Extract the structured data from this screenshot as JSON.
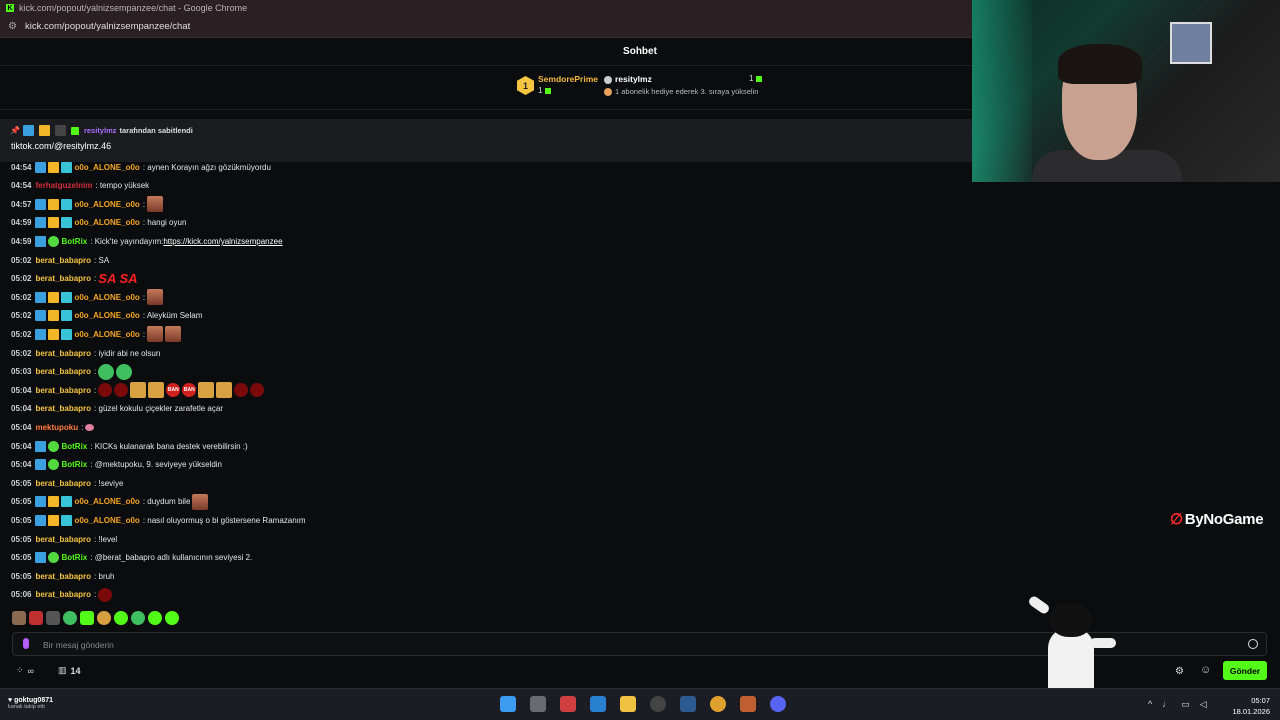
{
  "browser": {
    "window_title": "kick.com/popout/yalnizsempanzee/chat - Google Chrome",
    "url": "kick.com/popout/yalnizsempanzee/chat"
  },
  "chat": {
    "header_title": "Sohbet",
    "leaderboard": {
      "rank": "1",
      "top_user": "SemdorePrime",
      "top_user_count": "1",
      "second_user": "resitylmz",
      "second_user_count": "1",
      "sub_text": "1 abonelik hediye ederek 3. sıraya yükselin"
    },
    "pinned": {
      "pinned_by_user": "resitylmz",
      "pinned_by_text": "tarafından sabitlendi",
      "content": "tiktok.com/@resitylmz.46"
    },
    "messages": [
      {
        "time": "04:54",
        "user": "o0o_ALONE_o0o",
        "text": ": aynen Korayın ağzı gözükmüyordu"
      },
      {
        "time": "04:54",
        "user": "ferhatguzelnim",
        "text": ": tempo yüksek"
      },
      {
        "time": "04:57",
        "user": "o0o_ALONE_o0o",
        "text": ":"
      },
      {
        "time": "04:59",
        "user": "o0o_ALONE_o0o",
        "text": ": hangi oyun"
      },
      {
        "time": "04:59",
        "user": "BotRix",
        "text": ": Kick'te yayındayım: ",
        "link": "https://kick.com/yalnizsempanzee"
      },
      {
        "time": "05:02",
        "user": "berat_babapro",
        "text": ": SA"
      },
      {
        "time": "05:02",
        "user": "berat_babapro",
        "text": ":",
        "big": "SA SA"
      },
      {
        "time": "05:02",
        "user": "o0o_ALONE_o0o",
        "text": ":"
      },
      {
        "time": "05:02",
        "user": "o0o_ALONE_o0o",
        "text": ": Aleyküm Selam"
      },
      {
        "time": "05:02",
        "user": "o0o_ALONE_o0o",
        "text": ":"
      },
      {
        "time": "05:02",
        "user": "berat_babapro",
        "text": ": iyidir abi ne olsun"
      },
      {
        "time": "05:03",
        "user": "berat_babapro",
        "text": ":"
      },
      {
        "time": "05:04",
        "user": "berat_babapro",
        "text": ":",
        "ban": "BAN"
      },
      {
        "time": "05:04",
        "user": "berat_babapro",
        "text": ": güzel kokulu çiçekler zarafetle açar"
      },
      {
        "time": "05:04",
        "user": "mektupoku",
        "text": ":"
      },
      {
        "time": "05:04",
        "user": "BotRix",
        "text": ": KICKs kulanarak bana destek verebilirsin :)"
      },
      {
        "time": "05:04",
        "user": "BotRix",
        "text": ": @mektupoku, 9. seviyeye yükseldin"
      },
      {
        "time": "05:05",
        "user": "berat_babapro",
        "text": ": !seviye"
      },
      {
        "time": "05:05",
        "user": "o0o_ALONE_o0o",
        "text": ": duydum bile"
      },
      {
        "time": "05:05",
        "user": "o0o_ALONE_o0o",
        "text": ": nasıl oluyormuş o bi göstersene Ramazanım"
      },
      {
        "time": "05:05",
        "user": "berat_babapro",
        "text": ": !level"
      },
      {
        "time": "05:05",
        "user": "BotRix",
        "text": ": @berat_babapro adlı kullanıcının seviyesi 2."
      },
      {
        "time": "05:05",
        "user": "berat_babapro",
        "text": ": bruh"
      },
      {
        "time": "05:06",
        "user": "berat_babapro",
        "text": ":"
      }
    ],
    "input_placeholder": "Bir mesaj gönderin",
    "kicks_count": "14",
    "send_label": "Gönder"
  },
  "overlay": {
    "brand": "ByNoGame"
  },
  "taskbar": {
    "user": "goktug0871",
    "user_sub": "kanalı takip etti",
    "time": "05:07",
    "date": "18.01.2026"
  }
}
